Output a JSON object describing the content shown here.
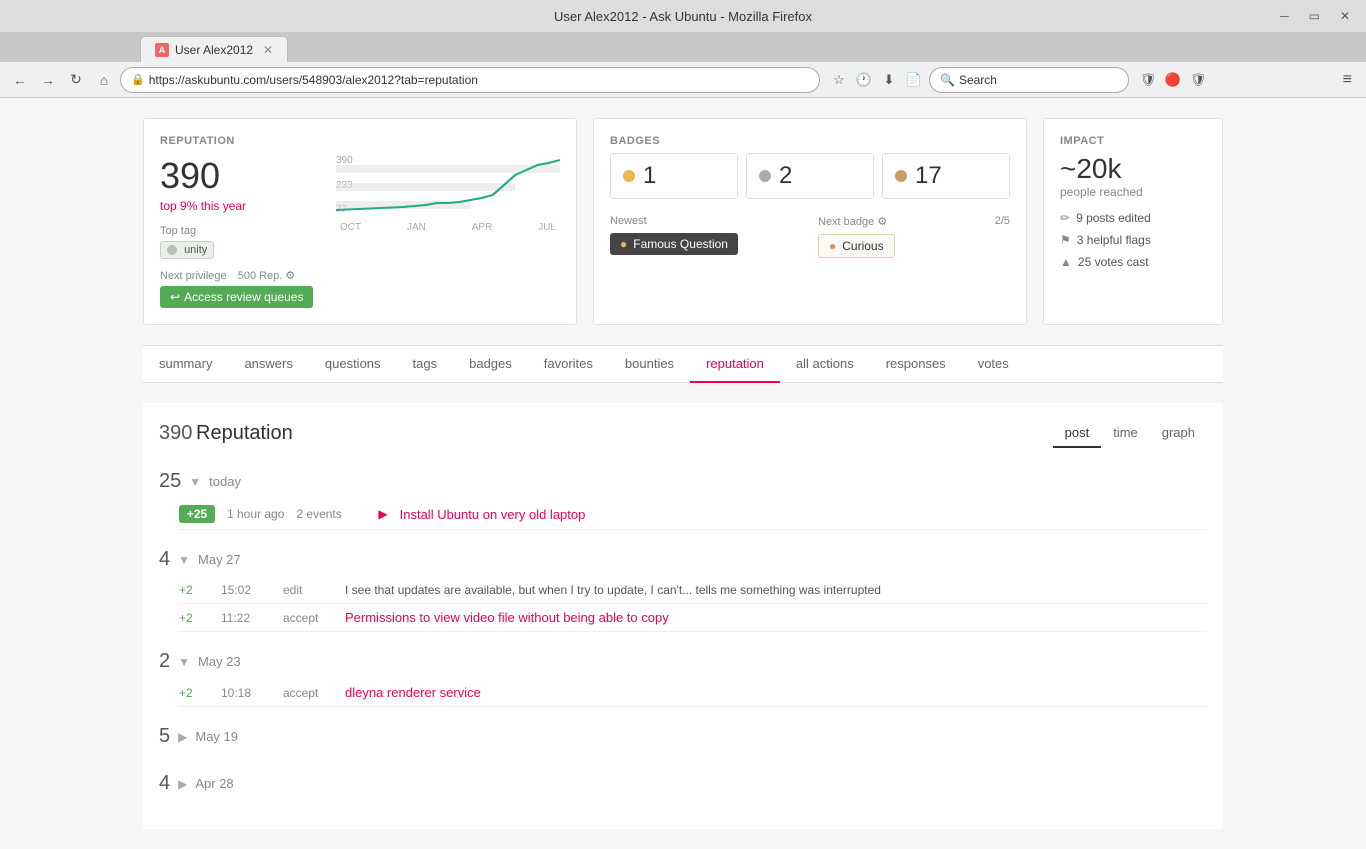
{
  "browser": {
    "title": "User Alex2012 - Ask Ubuntu - Mozilla Firefox",
    "tab_label": "User Alex2012",
    "url": "https://askubuntu.com/users/548903/alex2012?tab=reputation",
    "search_placeholder": "Search"
  },
  "reputation_card": {
    "label": "REPUTATION",
    "value": "390",
    "rank": "top 9% this year",
    "chart_y": [
      "390",
      "233",
      "77"
    ],
    "chart_x": [
      "OCT",
      "JAN",
      "APR",
      "JUL"
    ],
    "top_tag_label": "Top tag",
    "top_tag": "unity",
    "next_privilege_label": "Next privilege",
    "next_privilege_rep": "500 Rep.",
    "next_privilege_btn": "Access review queues"
  },
  "badges_card": {
    "label": "BADGES",
    "gold_count": "1",
    "silver_count": "2",
    "bronze_count": "17",
    "newest_label": "Newest",
    "newest_badge": "Famous Question",
    "next_badge_label": "Next badge",
    "next_badge_progress": "2/5",
    "next_badge_name": "Curious"
  },
  "impact_card": {
    "label": "IMPACT",
    "value": "~20k",
    "people_reached": "people reached",
    "posts_edited": "9 posts edited",
    "helpful_flags": "3 helpful flags",
    "votes_cast": "25 votes cast"
  },
  "tabs": [
    {
      "id": "summary",
      "label": "summary"
    },
    {
      "id": "answers",
      "label": "answers"
    },
    {
      "id": "questions",
      "label": "questions"
    },
    {
      "id": "tags",
      "label": "tags"
    },
    {
      "id": "badges",
      "label": "badges"
    },
    {
      "id": "favorites",
      "label": "favorites"
    },
    {
      "id": "bounties",
      "label": "bounties"
    },
    {
      "id": "reputation",
      "label": "reputation",
      "active": true
    },
    {
      "id": "all-actions",
      "label": "all actions"
    },
    {
      "id": "responses",
      "label": "responses"
    },
    {
      "id": "votes",
      "label": "votes"
    }
  ],
  "reputation_section": {
    "number": "390",
    "title": "Reputation",
    "view_tabs": [
      {
        "id": "post",
        "label": "post",
        "active": true
      },
      {
        "id": "time",
        "label": "time"
      },
      {
        "id": "graph",
        "label": "graph"
      }
    ],
    "groups": [
      {
        "total": "25",
        "date": "today",
        "entries": [
          {
            "badge": "+25",
            "time": "1 hour ago",
            "events": "2 events",
            "type": "",
            "link": "Install Ubuntu on very old laptop",
            "text": ""
          }
        ]
      },
      {
        "total": "4",
        "date": "May 27",
        "entries": [
          {
            "badge": "+2",
            "time": "15:02",
            "events": "",
            "type": "edit",
            "link": "",
            "text": "I see that updates are available, but when I try to update, I can't... tells me something was interrupted"
          },
          {
            "badge": "+2",
            "time": "11:22",
            "events": "",
            "type": "accept",
            "link": "Permissions to view video file without being able to copy",
            "text": ""
          }
        ]
      },
      {
        "total": "2",
        "date": "May 23",
        "entries": [
          {
            "badge": "+2",
            "time": "10:18",
            "events": "",
            "type": "accept",
            "link": "dleyna renderer service",
            "text": ""
          }
        ]
      },
      {
        "total": "5",
        "date": "May 19",
        "entries": []
      },
      {
        "total": "4",
        "date": "Apr 28",
        "entries": []
      }
    ]
  }
}
